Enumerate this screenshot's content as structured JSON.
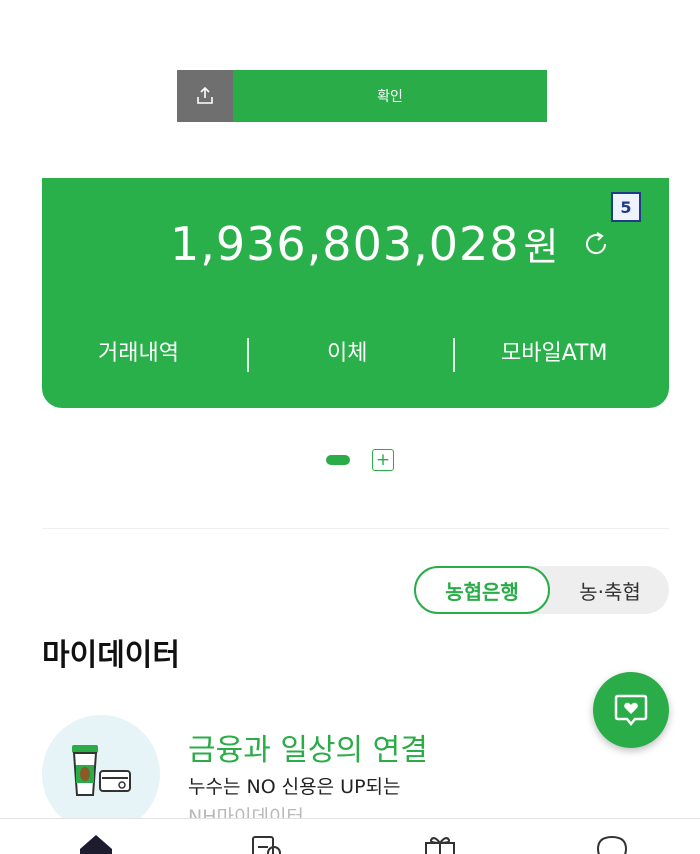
{
  "confirm_bar": {
    "share_icon": "share-upload-icon",
    "confirm_label": "확인"
  },
  "account_card": {
    "badge": "5",
    "balance_amount": "1,936,803,028",
    "balance_unit": "원",
    "refresh_icon": "refresh-icon",
    "actions": [
      "거래내역",
      "이체",
      "모바일ATM"
    ],
    "color": "#2ab04a"
  },
  "pager": {
    "add_icon": "plus-square-icon"
  },
  "bank_toggle": {
    "options": [
      "농협은행",
      "농·축협"
    ],
    "selected": "농협은행"
  },
  "mydata": {
    "title": "마이데이터",
    "promo_title": "금융과 일상의 연결",
    "promo_subtitle": "누수는 NO 신용은 UP되는",
    "promo_subtitle2": "NH마이데이터",
    "promo_icon": "coffee-card-icon"
  },
  "fab": {
    "icon": "chat-heart-icon"
  },
  "bottom_nav": {
    "icons": [
      "home-icon",
      "receipt-icon",
      "gift-icon",
      "chat-icon"
    ]
  },
  "colors": {
    "brand_green": "#2aac48",
    "share_gray": "#6f6f6f",
    "badge_border": "#1f3c88"
  }
}
